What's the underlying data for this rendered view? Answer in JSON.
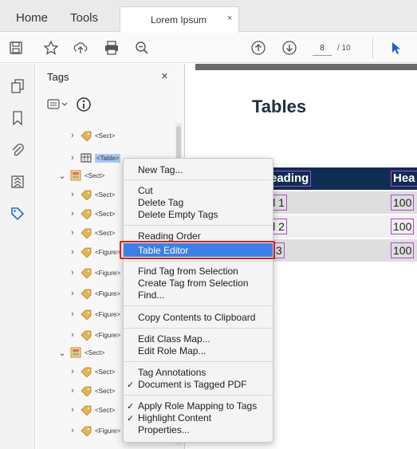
{
  "tabs": {
    "home": "Home",
    "tools": "Tools",
    "document": "Lorem Ipsum",
    "close_glyph": "×"
  },
  "toolbar": {
    "page_current": "8",
    "page_total": "/ 10"
  },
  "tags_panel": {
    "title": "Tags",
    "close_glyph": "×",
    "rows": [
      {
        "label": "<Sect>",
        "caret": "›"
      },
      {
        "label": "<Table>",
        "caret": "›"
      },
      {
        "label": "<Sect>",
        "caret": "⌄"
      },
      {
        "label": "<Sect>",
        "caret": "›"
      },
      {
        "label": "<Sect>",
        "caret": "›"
      },
      {
        "label": "<Sect>",
        "caret": "›"
      },
      {
        "label": "<Figure>",
        "caret": "›"
      },
      {
        "label": "<Figure>",
        "caret": "›"
      },
      {
        "label": "<Figure>",
        "caret": "›"
      },
      {
        "label": "<Figure>",
        "caret": "›"
      },
      {
        "label": "<Figure>",
        "caret": "›"
      },
      {
        "label": "<Sect>",
        "caret": "⌄"
      },
      {
        "label": "<Sect>",
        "caret": "›"
      },
      {
        "label": "<Sect>",
        "caret": "›"
      },
      {
        "label": "<Sect>",
        "caret": "›"
      },
      {
        "label": "<Figure>",
        "caret": "›"
      }
    ]
  },
  "document": {
    "title": "Tables",
    "header": [
      "eading",
      "Hea"
    ],
    "rows": [
      [
        "ll 1",
        "100"
      ],
      [
        "ll 2",
        "100"
      ],
      [
        "l 3",
        "100"
      ]
    ]
  },
  "context_menu": {
    "items": [
      "New Tag...",
      "Cut",
      "Delete Tag",
      "Delete Empty Tags",
      "Reading Order",
      "Table Editor",
      "Find Tag from Selection",
      "Create Tag from Selection",
      "Find...",
      "Copy Contents to Clipboard",
      "Edit Class Map...",
      "Edit Role Map...",
      "Tag Annotations",
      "Document is Tagged PDF",
      "Apply Role Mapping to Tags",
      "Highlight Content",
      "Properties..."
    ],
    "check_glyph": "✓",
    "highlighted_item": "Table Editor"
  },
  "colors": {
    "highlight": "#3d7fe6",
    "table_header": "#0f2d52",
    "tag_outline": "#b04ac9",
    "callout": "#d0201e"
  }
}
